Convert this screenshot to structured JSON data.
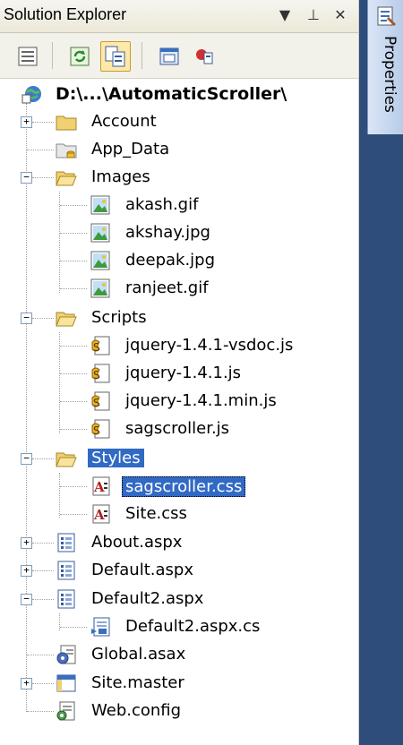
{
  "panel": {
    "title": "Solution Explorer",
    "buttons": {
      "dropdown": "▼",
      "pin": "⊥",
      "close": "✕"
    }
  },
  "toolbar": {
    "buttons": [
      {
        "name": "properties-toolbar-icon"
      },
      {
        "name": "refresh-icon"
      },
      {
        "name": "show-all-files-icon"
      },
      {
        "name": "view-designer-icon"
      },
      {
        "name": "class-diagram-icon"
      }
    ]
  },
  "tree": {
    "root": "D:\\...\\AutomaticScroller\\",
    "items": [
      {
        "label": "Account",
        "icon": "folder-icon",
        "expander": "+"
      },
      {
        "label": "App_Data",
        "icon": "folder-data-icon"
      },
      {
        "label": "Images",
        "icon": "folder-open-icon",
        "expander": "−"
      },
      {
        "label": "akash.gif",
        "icon": "image-file-icon"
      },
      {
        "label": "akshay.jpg",
        "icon": "image-file-icon"
      },
      {
        "label": "deepak.jpg",
        "icon": "image-file-icon"
      },
      {
        "label": "ranjeet.gif",
        "icon": "image-file-icon"
      },
      {
        "label": "Scripts",
        "icon": "folder-open-icon",
        "expander": "−"
      },
      {
        "label": "jquery-1.4.1-vsdoc.js",
        "icon": "script-file-icon"
      },
      {
        "label": "jquery-1.4.1.js",
        "icon": "script-file-icon"
      },
      {
        "label": "jquery-1.4.1.min.js",
        "icon": "script-file-icon"
      },
      {
        "label": "sagscroller.js",
        "icon": "script-file-icon"
      },
      {
        "label": "Styles",
        "icon": "folder-open-icon",
        "expander": "−"
      },
      {
        "label": "sagscroller.css",
        "icon": "css-file-icon"
      },
      {
        "label": "Site.css",
        "icon": "css-file-icon"
      },
      {
        "label": "About.aspx",
        "icon": "aspx-file-icon",
        "expander": "+"
      },
      {
        "label": "Default.aspx",
        "icon": "aspx-file-icon",
        "expander": "+"
      },
      {
        "label": "Default2.aspx",
        "icon": "aspx-file-icon",
        "expander": "−"
      },
      {
        "label": "Default2.aspx.cs",
        "icon": "cs-file-icon"
      },
      {
        "label": "Global.asax",
        "icon": "global-asax-icon"
      },
      {
        "label": "Site.master",
        "icon": "master-page-icon",
        "expander": "+"
      },
      {
        "label": "Web.config",
        "icon": "config-file-icon"
      }
    ]
  },
  "side_panel": {
    "tab_label": "Properties"
  },
  "colors": {
    "selection": "#316ac5",
    "side_background": "#2f4d7a"
  }
}
